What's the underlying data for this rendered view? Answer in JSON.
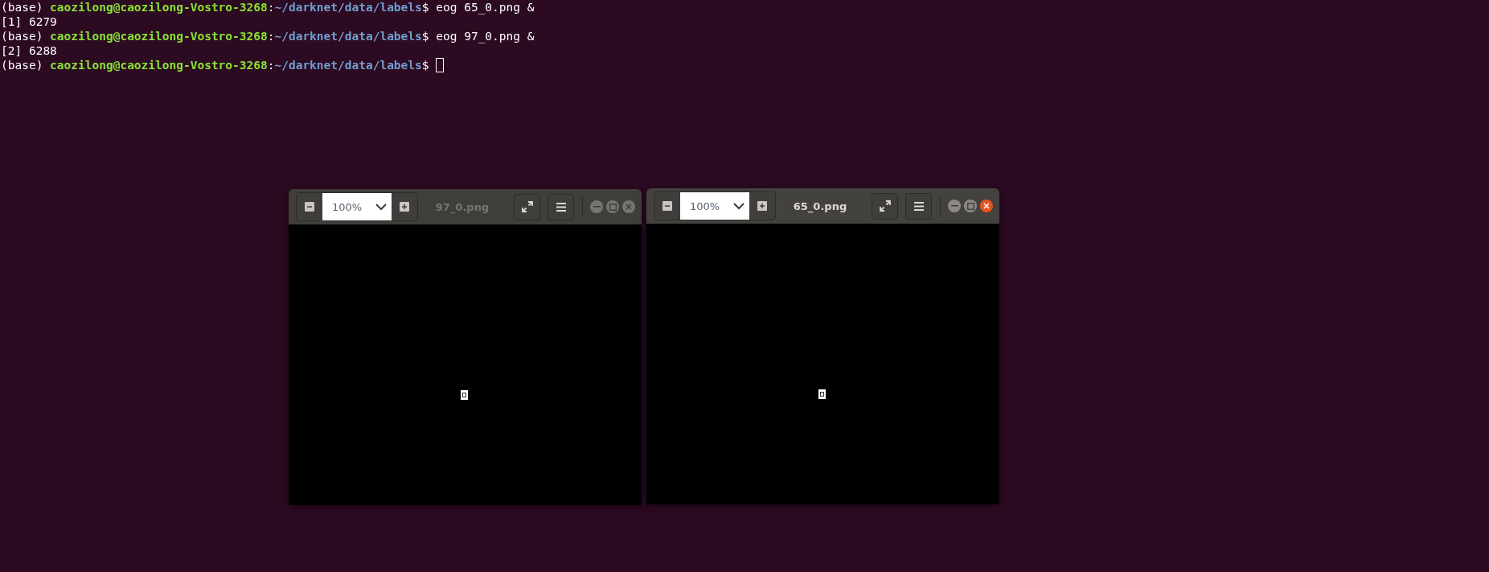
{
  "terminal": {
    "lines": [
      {
        "kind": "prompt",
        "env": "(base)",
        "user_host": "caozilong@caozilong-Vostro-3268",
        "separator": ":",
        "path": "~/darknet/data/labels",
        "symbol": "$",
        "command": "eog 65_0.png &",
        "cursor": false
      },
      {
        "kind": "output",
        "text": "[1] 6279"
      },
      {
        "kind": "prompt",
        "env": "(base)",
        "user_host": "caozilong@caozilong-Vostro-3268",
        "separator": ":",
        "path": "~/darknet/data/labels",
        "symbol": "$",
        "command": "eog 97_0.png &",
        "cursor": false
      },
      {
        "kind": "output",
        "text": "[2] 6288"
      },
      {
        "kind": "prompt",
        "env": "(base)",
        "user_host": "caozilong@caozilong-Vostro-3268",
        "separator": ":",
        "path": "~/darknet/data/labels",
        "symbol": "$",
        "cursor": true
      }
    ]
  },
  "windows": [
    {
      "title": "97_0.png",
      "zoom": "100%",
      "focused": false
    },
    {
      "title": "65_0.png",
      "zoom": "100%",
      "focused": true
    }
  ]
}
